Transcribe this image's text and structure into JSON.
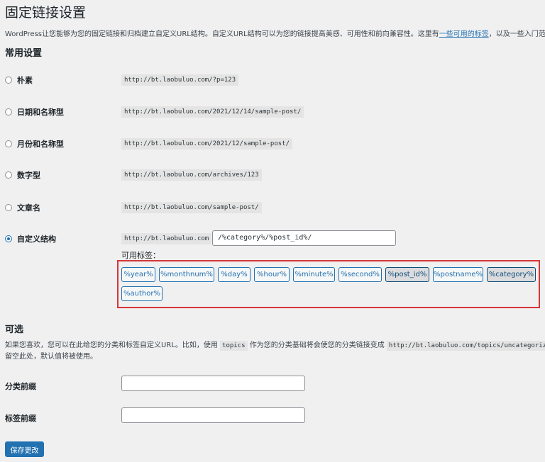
{
  "page": {
    "title": "固定链接设置",
    "intro_before": "WordPress让您能够为您的固定链接和归档建立自定义URL结构。自定义URL结构可以为您的链接提高美感、可用性和前向兼容性。这里有",
    "intro_link": "一些可用的标签",
    "intro_after": "，以及一些入门范例。"
  },
  "common": {
    "heading": "常用设置",
    "options": [
      {
        "label": "朴素",
        "url": "http://bt.laobuluo.com/?p=123",
        "checked": false
      },
      {
        "label": "日期和名称型",
        "url": "http://bt.laobuluo.com/2021/12/14/sample-post/",
        "checked": false
      },
      {
        "label": "月份和名称型",
        "url": "http://bt.laobuluo.com/2021/12/sample-post/",
        "checked": false
      },
      {
        "label": "数字型",
        "url": "http://bt.laobuluo.com/archives/123",
        "checked": false
      },
      {
        "label": "文章名",
        "url": "http://bt.laobuluo.com/sample-post/",
        "checked": false
      },
      {
        "label": "自定义结构",
        "url": "http://bt.laobuluo.com",
        "checked": true
      }
    ],
    "custom_value": "/%category%/%post_id%/",
    "tags_label": "可用标签：",
    "tags": [
      {
        "label": "%year%",
        "active": false
      },
      {
        "label": "%monthnum%",
        "active": false
      },
      {
        "label": "%day%",
        "active": false
      },
      {
        "label": "%hour%",
        "active": false
      },
      {
        "label": "%minute%",
        "active": false
      },
      {
        "label": "%second%",
        "active": false
      },
      {
        "label": "%post_id%",
        "active": true
      },
      {
        "label": "%postname%",
        "active": false
      },
      {
        "label": "%category%",
        "active": true
      },
      {
        "label": "%author%",
        "active": false
      }
    ]
  },
  "optional": {
    "heading": "可选",
    "desc_1": "如果您喜欢，您可以在此给您的分类和标签自定义URL。比如，使用",
    "desc_code1": "topics",
    "desc_2": "作为您的分类基础将会使您的分类链接变成",
    "desc_code2": "http://bt.laobuluo.com/topics/uncategorized/",
    "desc_3": "。",
    "desc_4": "留空此处，默认值将被使用。",
    "category_base_label": "分类前缀",
    "category_base_value": "",
    "tag_base_label": "标签前缀",
    "tag_base_value": ""
  },
  "save_label": "保存更改",
  "colors": {
    "accent": "#2271b1",
    "highlight_border": "#d63638",
    "background": "#f0f0f1"
  }
}
